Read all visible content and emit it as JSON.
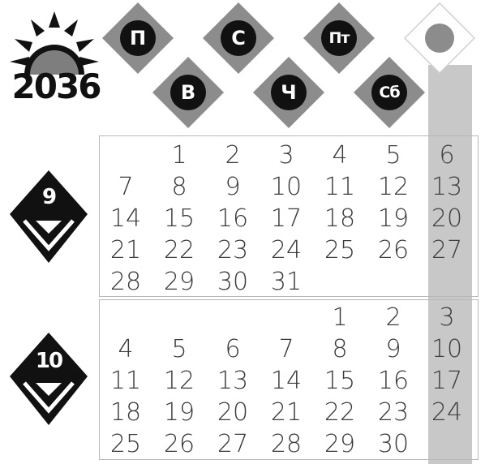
{
  "year": "2036",
  "weekdays": [
    "П",
    "В",
    "С",
    "Ч",
    "Пт",
    "Сб"
  ],
  "colors": {
    "tile": "#8c8c8c",
    "sunday_band": "#c8c8c8",
    "badge": "#111111"
  },
  "months": [
    {
      "label": "9",
      "days": [
        "",
        "1",
        "2",
        "3",
        "4",
        "5",
        "6",
        "7",
        "8",
        "9",
        "10",
        "11",
        "12",
        "13",
        "14",
        "15",
        "16",
        "17",
        "18",
        "19",
        "20",
        "21",
        "22",
        "23",
        "24",
        "25",
        "26",
        "27",
        "28",
        "29",
        "30",
        "31",
        "",
        "",
        ""
      ]
    },
    {
      "label": "10",
      "days": [
        "",
        "",
        "",
        "",
        "1",
        "2",
        "3",
        "4",
        "5",
        "6",
        "7",
        "8",
        "9",
        "10",
        "11",
        "12",
        "13",
        "14",
        "15",
        "16",
        "17",
        "18",
        "19",
        "20",
        "21",
        "22",
        "23",
        "24",
        "25",
        "26",
        "27",
        "28",
        "29",
        "30",
        ""
      ]
    }
  ]
}
